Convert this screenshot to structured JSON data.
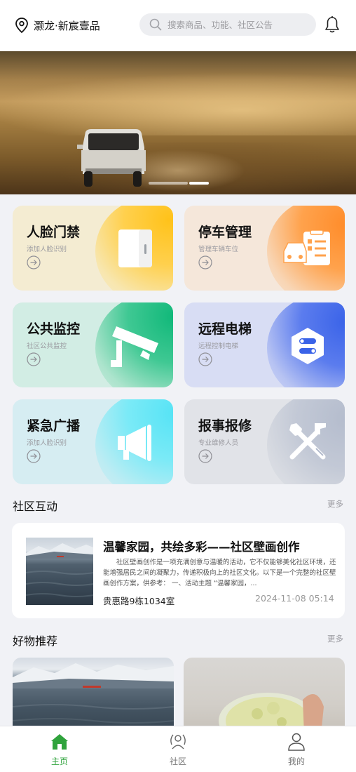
{
  "header": {
    "location": "灏龙·新宸壹品",
    "search_placeholder": "搜索商品、功能、社区公告",
    "location_icon": "location-pin-icon",
    "search_icon": "search-icon",
    "bell_icon": "bell-icon"
  },
  "banner": {
    "slide_count": 2,
    "active_index": 1
  },
  "features": [
    {
      "title": "人脸门禁",
      "subtitle": "添加人脸识别",
      "icon": "door-icon",
      "color": "#ffc21a"
    },
    {
      "title": "停车管理",
      "subtitle": "管理车辆车位",
      "icon": "parking-icon",
      "color": "#ff8c2a"
    },
    {
      "title": "公共监控",
      "subtitle": "社区公共监控",
      "icon": "camera-icon",
      "color": "#10b879"
    },
    {
      "title": "远程电梯",
      "subtitle": "远程控制电梯",
      "icon": "elevator-icon",
      "color": "#3a63e8"
    },
    {
      "title": "紧急广播",
      "subtitle": "添加人脸识别",
      "icon": "megaphone-icon",
      "color": "#56e3f5"
    },
    {
      "title": "报事报修",
      "subtitle": "专业维修人员",
      "icon": "repair-tools-icon",
      "color": "#b4bccd"
    }
  ],
  "community": {
    "title": "社区互动",
    "more": "更多",
    "post": {
      "title": "温馨家园，共绘多彩——社区壁画创作",
      "body": "社区壁画创作是一项充满创意与温暖的活动，它不仅能够美化社区环境，还能增强居民之间的凝聚力，传递积极向上的社区文化。以下是一个完整的社区壁画创作方案，供参考：  一、活动主题 “温馨家园，...",
      "address": "贵惠路9栋1034室",
      "time": "2024-11-08 05:14"
    }
  },
  "goods": {
    "title": "好物推荐",
    "more": "更多"
  },
  "tabbar": {
    "items": [
      {
        "label": "主页",
        "icon": "home-icon",
        "active": true
      },
      {
        "label": "社区",
        "icon": "community-icon",
        "active": false
      },
      {
        "label": "我的",
        "icon": "user-icon",
        "active": false
      }
    ],
    "accent": "#2fa33c"
  }
}
